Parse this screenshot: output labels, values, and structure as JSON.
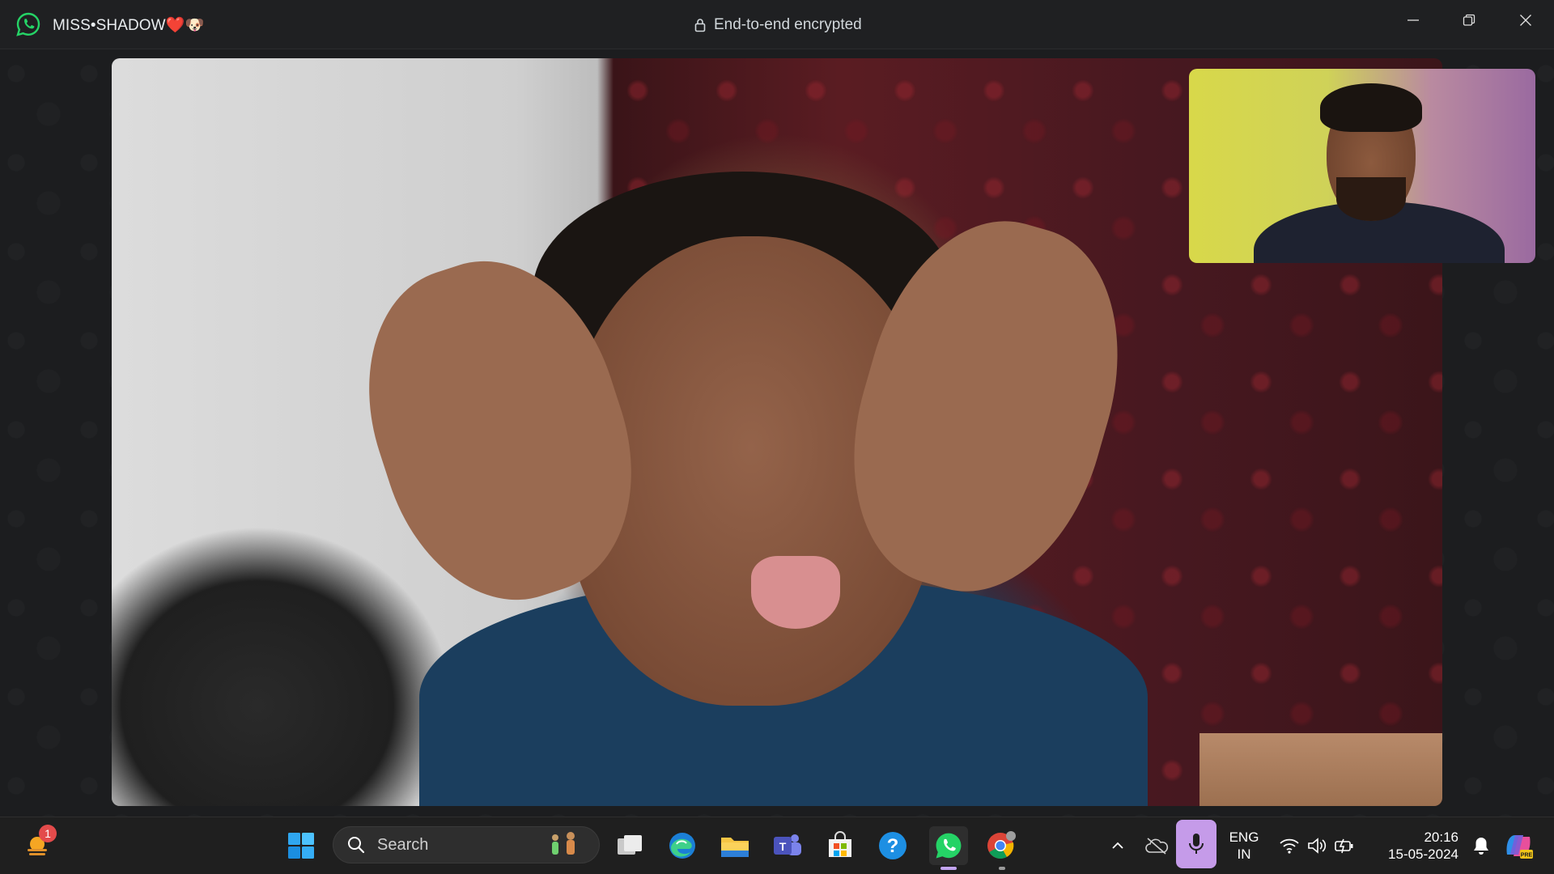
{
  "titlebar": {
    "app_name": "WhatsApp",
    "contact_name": "MISS•SHADOW❤️🐶",
    "encryption_text": "End-to-end encrypted",
    "window_controls": [
      "minimize",
      "restore",
      "close"
    ]
  },
  "call": {
    "remote_video": "remote-participant-video",
    "self_view": "self-view-video"
  },
  "taskbar": {
    "weather_badge_count": "1",
    "search_placeholder": "Search",
    "pinned_apps": [
      "start",
      "task-view",
      "edge",
      "file-explorer",
      "teams",
      "microsoft-store",
      "get-help",
      "whatsapp",
      "chrome"
    ],
    "tray": {
      "language_line1": "ENG",
      "language_line2": "IN",
      "time": "20:16",
      "date": "15-05-2024"
    }
  },
  "colors": {
    "whatsapp_green": "#25d366",
    "taskbar_bg": "#1f1f1f",
    "mic_active": "#c59be9"
  }
}
